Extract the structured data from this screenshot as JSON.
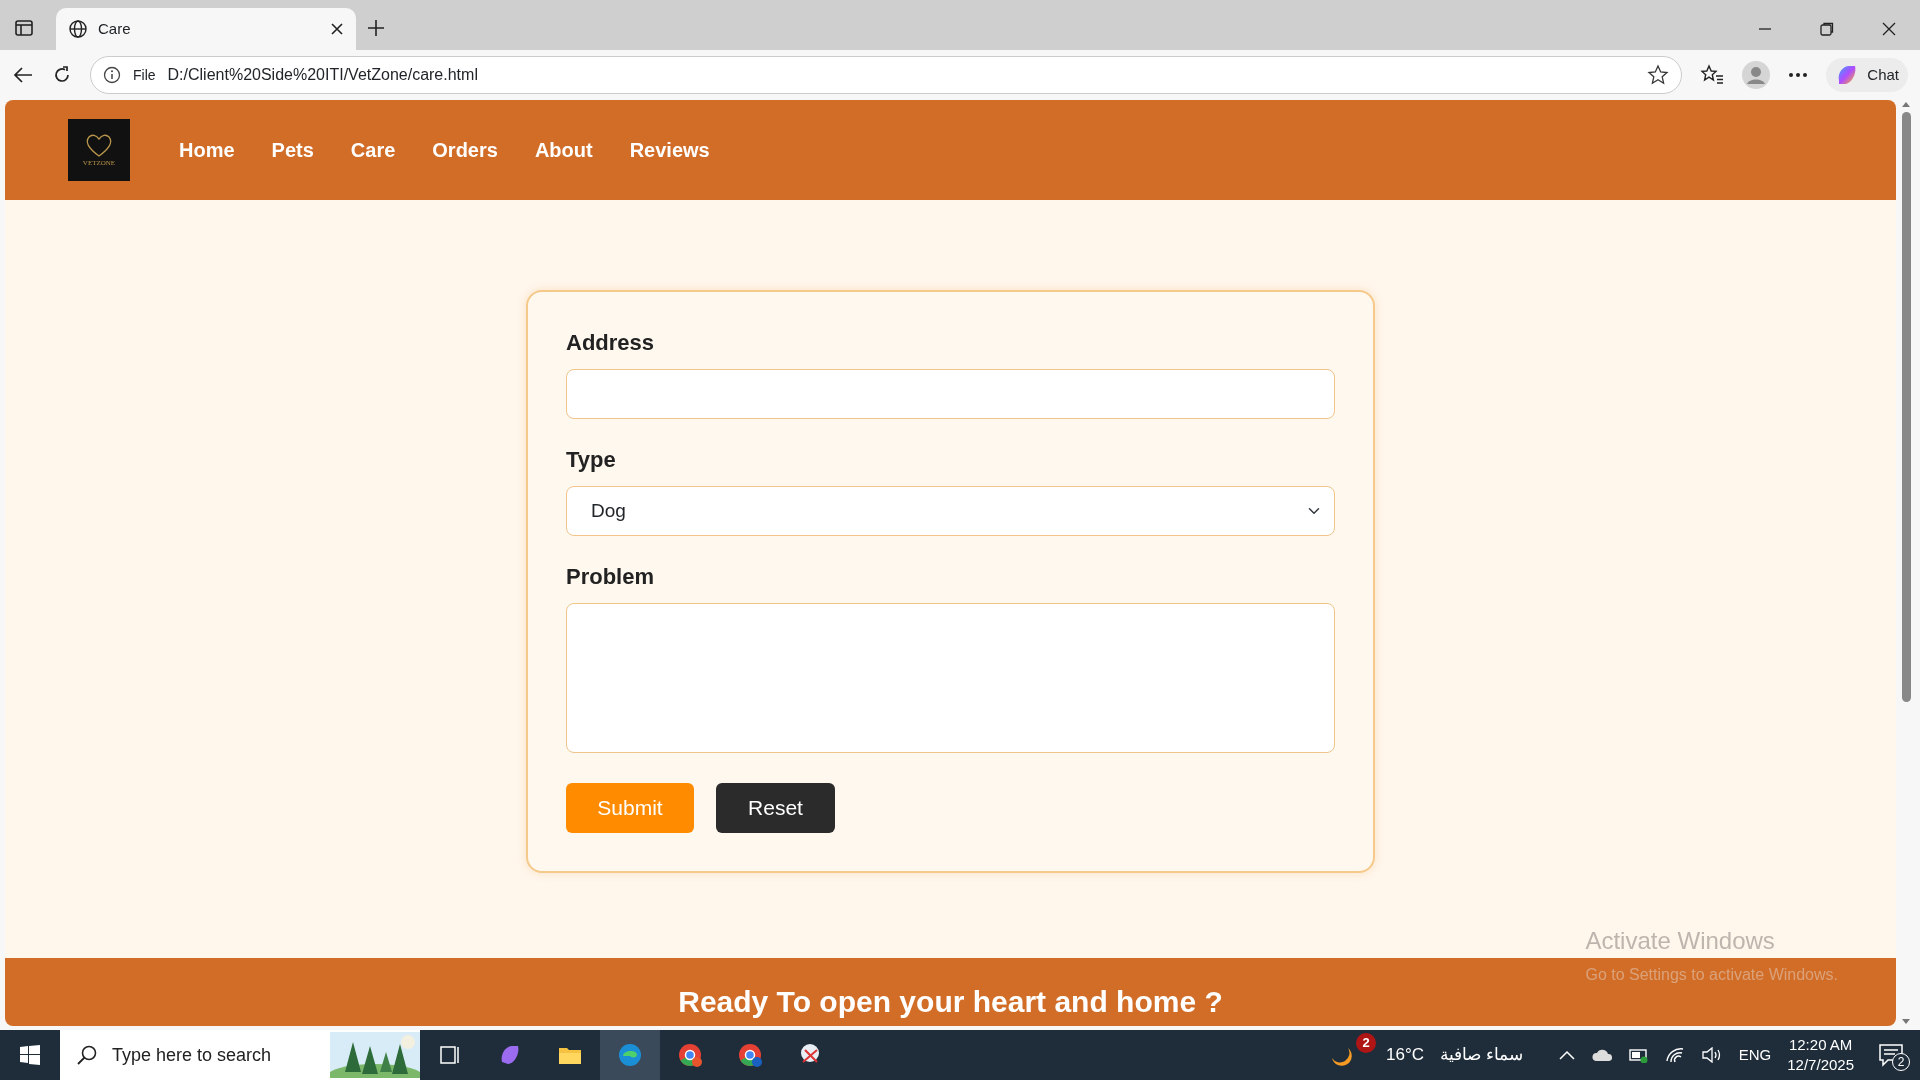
{
  "browser": {
    "tab_title": "Care",
    "address_prefix": "File",
    "url": "D:/Client%20Side%20ITI/VetZone/care.html",
    "chat": "Chat"
  },
  "navbar": {
    "logo_text": "VETZONE",
    "links": [
      {
        "label": "Home"
      },
      {
        "label": "Pets"
      },
      {
        "label": "Care"
      },
      {
        "label": "Orders"
      },
      {
        "label": "About"
      },
      {
        "label": "Reviews"
      }
    ]
  },
  "form": {
    "fields": [
      {
        "kind": "input",
        "label": "Address"
      },
      {
        "kind": "select",
        "label": "Type",
        "value": "Dog"
      },
      {
        "kind": "textarea",
        "label": "Problem"
      }
    ],
    "buttons": [
      {
        "kind": "submit",
        "label": "Submit"
      },
      {
        "kind": "reset",
        "label": "Reset"
      }
    ]
  },
  "footer": {
    "heading": "Ready To open your heart and home ?"
  },
  "activation": {
    "title": "Activate Windows",
    "subtitle": "Go to Settings to activate Windows."
  },
  "taskbar": {
    "search_placeholder": "Type here to search",
    "weather_badge": "2",
    "temperature": "16°C",
    "condition": "سماء صافية",
    "language": "ENG",
    "time": "12:20 AM",
    "date": "12/7/2025",
    "notifications": "2"
  }
}
